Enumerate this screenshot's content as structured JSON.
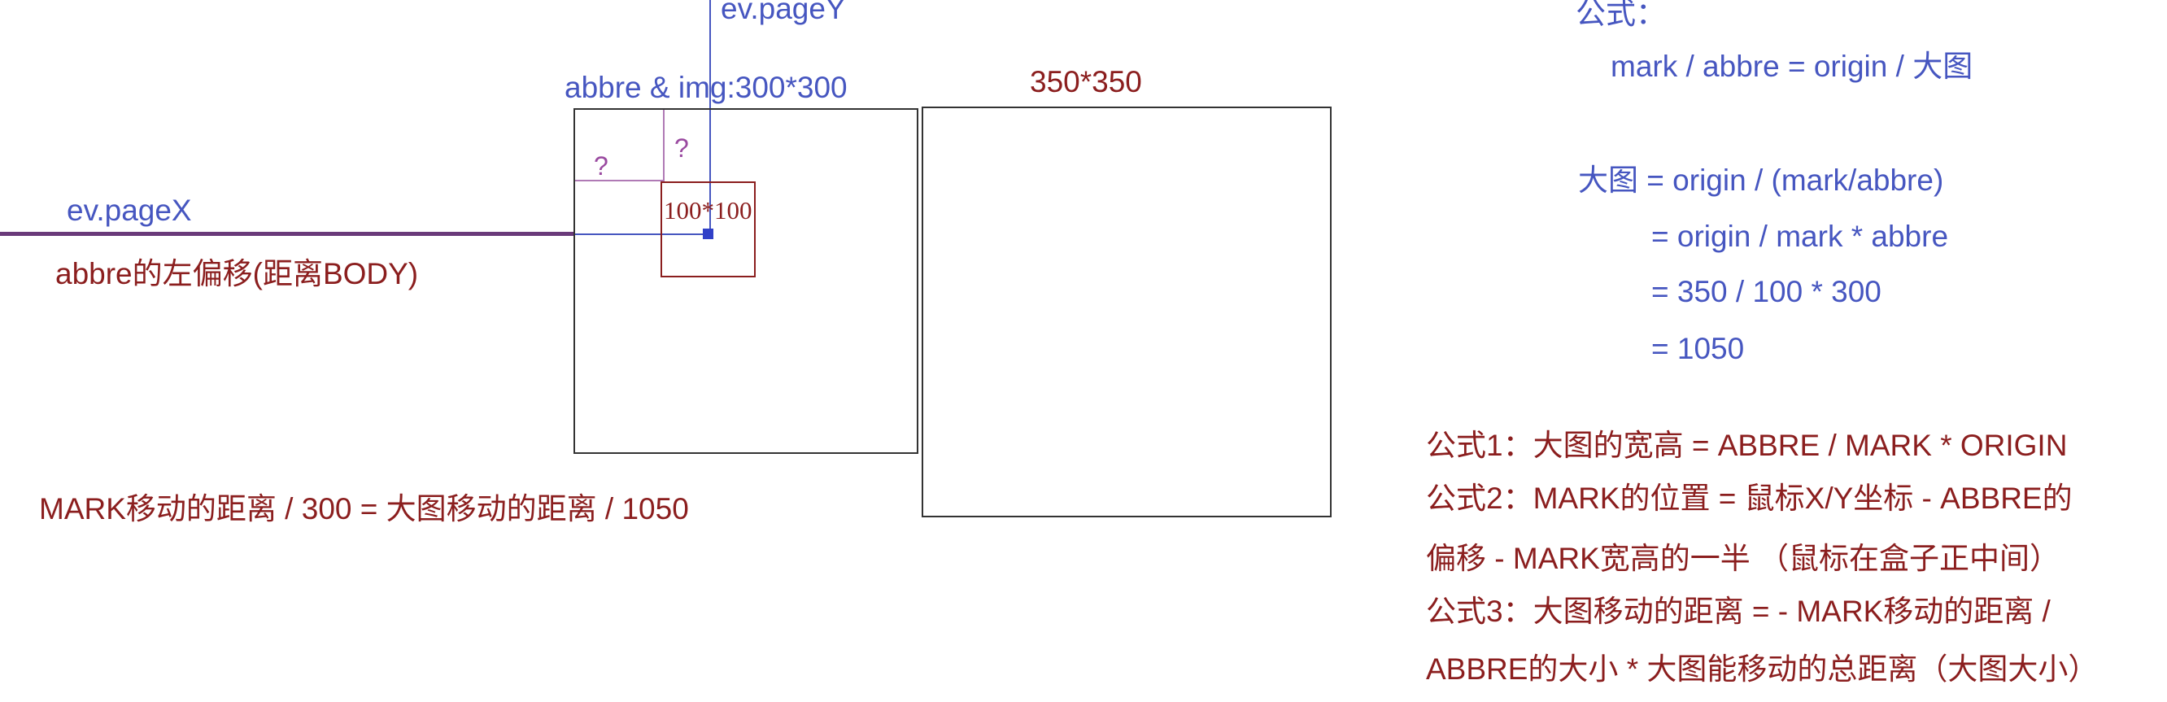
{
  "diagram": {
    "label_page_y": "ev.pageY",
    "label_page_x": "ev.pageX",
    "label_abbre": "abbre & img:300*300",
    "label_origin": "350*350",
    "label_mark": "100*100",
    "question_left": "?",
    "question_top": "?",
    "label_abbre_offset": "abbre的左偏移(距离BODY)",
    "ratio_formula": "MARK移动的距离 / 300 = 大图移动的距离 / 1050"
  },
  "formulas": {
    "title": "公式：",
    "lines": [
      "mark / abbre = origin / 大图",
      "大图 = origin / (mark/abbre)",
      "= origin / mark * abbre",
      "= 350 / 100 * 300",
      "= 1050"
    ]
  },
  "rules": [
    "公式1：大图的宽高 = ABBRE / MARK * ORIGIN",
    "公式2：MARK的位置 = 鼠标X/Y坐标 - ABBRE的",
    "偏移 - MARK宽高的一半 （鼠标在盒子正中间）",
    "公式3：大图移动的距离 = - MARK移动的距离 /",
    "ABBRE的大小 * 大图能移动的总距离（大图大小）"
  ],
  "colors": {
    "blue": "#4656c0",
    "red": "#8b1e1e",
    "purple": "#9a4aa0"
  }
}
